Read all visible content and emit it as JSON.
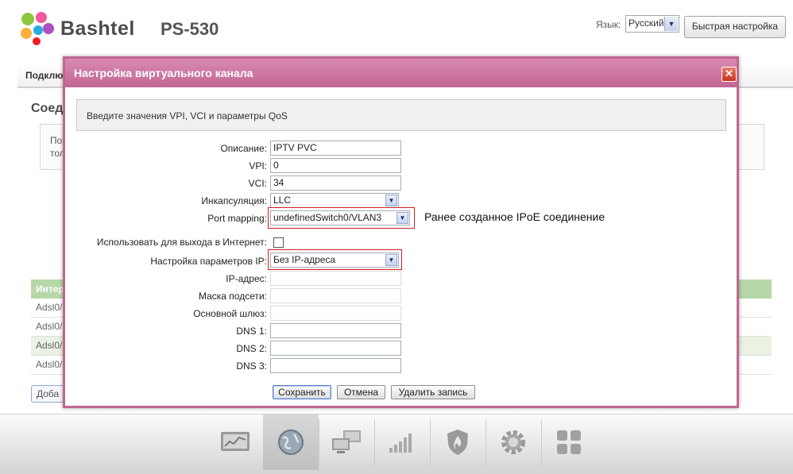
{
  "header": {
    "brand": "Bashtel",
    "model": "PS-530",
    "language_label": "Язык:",
    "language_value": "Русский",
    "quick_setup_label": "Быстрая настройка"
  },
  "background_page": {
    "nav_tab": "Подклю",
    "heading": "Соед",
    "info_line1": "По",
    "info_line2": "тол",
    "table_header": "Интер",
    "table_rows": [
      "Adsl0/",
      "Adsl0/",
      "Adsl0/",
      "Adsl0/"
    ],
    "add_button": "Доба"
  },
  "modal": {
    "title": "Настройка виртуального канала",
    "hint": "Введите значения VPI, VCI и параметры QoS",
    "fields": {
      "description_label": "Описание:",
      "description_value": "IPTV PVC",
      "vpi_label": "VPI:",
      "vpi_value": "0",
      "vci_label": "VCI:",
      "vci_value": "34",
      "encapsulation_label": "Инкапсуляция:",
      "encapsulation_value": "LLC",
      "port_mapping_label": "Port mapping:",
      "port_mapping_value": "undefinedSwitch0/VLAN3",
      "internet_label": "Использовать для выхода в Интернет:",
      "ip_settings_label": "Настройка параметров IP:",
      "ip_settings_value": "Без IP-адреса",
      "ip_address_label": "IP-адрес:",
      "subnet_mask_label": "Маска подсети:",
      "gateway_label": "Основной шлюз:",
      "dns1_label": "DNS 1:",
      "dns2_label": "DNS 2:",
      "dns3_label": "DNS 3:"
    },
    "annotation": "Ранее созданное IPoE соединение",
    "buttons": {
      "save": "Сохранить",
      "cancel": "Отмена",
      "delete": "Удалить запись"
    }
  },
  "dock": {
    "items": [
      "monitor-chart-icon",
      "globe-icon",
      "network-computers-icon",
      "signal-bars-icon",
      "shield-icon",
      "gear-icon",
      "apps-grid-icon"
    ],
    "active_index": 1
  },
  "colors": {
    "modal_title_bar": "#c36593",
    "modal_border": "#c06791",
    "highlight_red": "#d02020",
    "table_header_green": "#b6d8a8"
  }
}
